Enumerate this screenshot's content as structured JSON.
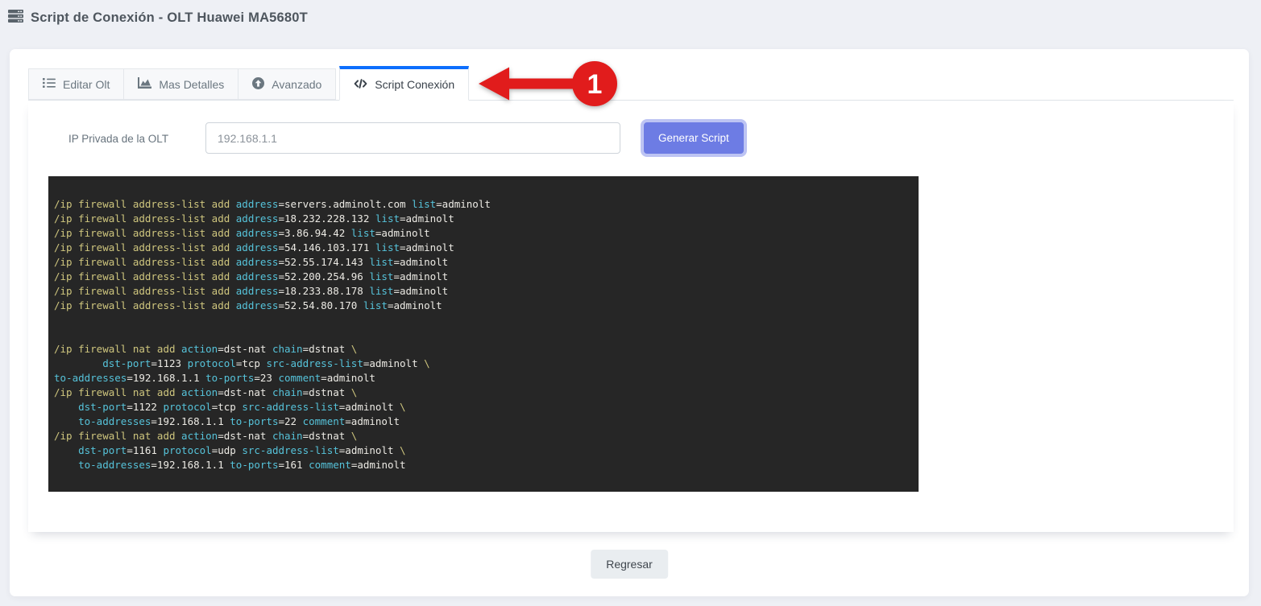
{
  "header": {
    "title": "Script de Conexión - OLT Huawei MA5680T"
  },
  "tabs": [
    {
      "label": "Editar Olt",
      "icon": "list-icon",
      "active": false
    },
    {
      "label": "Mas Detalles",
      "icon": "chart-area-icon",
      "active": false
    },
    {
      "label": "Avanzado",
      "icon": "arrow-circle-up-icon",
      "active": false
    },
    {
      "label": "Script Conexión",
      "icon": "code-icon",
      "active": true
    }
  ],
  "form": {
    "ip_label": "IP Privada de la OLT",
    "ip_value": "192.168.1.1",
    "generate_button_label": "Generar Script"
  },
  "footer": {
    "back_button_label": "Regresar"
  },
  "annotation": {
    "step_number": "1"
  },
  "colors": {
    "accent_blue": "#0d6efd",
    "button_purple": "#6d7ce4",
    "code_bg": "#262626",
    "code_yellow": "#cfc67e",
    "code_cyan": "#56c3da",
    "code_white": "#eceae4",
    "annotation_red": "#e11c1c"
  },
  "code": {
    "lines": [
      [
        [
          "y",
          "/ip firewall address-list add "
        ],
        [
          "c",
          "address"
        ],
        [
          "w",
          "=servers.adminolt.com "
        ],
        [
          "c",
          "list"
        ],
        [
          "w",
          "=adminolt"
        ]
      ],
      [
        [
          "y",
          "/ip firewall address-list add "
        ],
        [
          "c",
          "address"
        ],
        [
          "w",
          "=18.232.228.132 "
        ],
        [
          "c",
          "list"
        ],
        [
          "w",
          "=adminolt"
        ]
      ],
      [
        [
          "y",
          "/ip firewall address-list add "
        ],
        [
          "c",
          "address"
        ],
        [
          "w",
          "=3.86.94.42 "
        ],
        [
          "c",
          "list"
        ],
        [
          "w",
          "=adminolt"
        ]
      ],
      [
        [
          "y",
          "/ip firewall address-list add "
        ],
        [
          "c",
          "address"
        ],
        [
          "w",
          "=54.146.103.171 "
        ],
        [
          "c",
          "list"
        ],
        [
          "w",
          "=adminolt"
        ]
      ],
      [
        [
          "y",
          "/ip firewall address-list add "
        ],
        [
          "c",
          "address"
        ],
        [
          "w",
          "=52.55.174.143 "
        ],
        [
          "c",
          "list"
        ],
        [
          "w",
          "=adminolt"
        ]
      ],
      [
        [
          "y",
          "/ip firewall address-list add "
        ],
        [
          "c",
          "address"
        ],
        [
          "w",
          "=52.200.254.96 "
        ],
        [
          "c",
          "list"
        ],
        [
          "w",
          "=adminolt"
        ]
      ],
      [
        [
          "y",
          "/ip firewall address-list add "
        ],
        [
          "c",
          "address"
        ],
        [
          "w",
          "=18.233.88.178 "
        ],
        [
          "c",
          "list"
        ],
        [
          "w",
          "=adminolt"
        ]
      ],
      [
        [
          "y",
          "/ip firewall address-list add "
        ],
        [
          "c",
          "address"
        ],
        [
          "w",
          "=52.54.80.170 "
        ],
        [
          "c",
          "list"
        ],
        [
          "w",
          "=adminolt"
        ]
      ],
      [],
      [],
      [
        [
          "y",
          "/ip firewall nat add "
        ],
        [
          "c",
          "action"
        ],
        [
          "w",
          "=dst-nat "
        ],
        [
          "c",
          "chain"
        ],
        [
          "w",
          "=dstnat "
        ],
        [
          "y",
          "\\"
        ]
      ],
      [
        [
          "w",
          "        "
        ],
        [
          "c",
          "dst-port"
        ],
        [
          "w",
          "=1123 "
        ],
        [
          "c",
          "protocol"
        ],
        [
          "w",
          "=tcp "
        ],
        [
          "c",
          "src-address-list"
        ],
        [
          "w",
          "=adminolt "
        ],
        [
          "y",
          "\\"
        ]
      ],
      [
        [
          "c",
          "to-addresses"
        ],
        [
          "w",
          "=192.168.1.1 "
        ],
        [
          "c",
          "to-ports"
        ],
        [
          "w",
          "=23 "
        ],
        [
          "c",
          "comment"
        ],
        [
          "w",
          "=adminolt"
        ]
      ],
      [
        [
          "y",
          "/ip firewall nat add "
        ],
        [
          "c",
          "action"
        ],
        [
          "w",
          "=dst-nat "
        ],
        [
          "c",
          "chain"
        ],
        [
          "w",
          "=dstnat "
        ],
        [
          "y",
          "\\"
        ]
      ],
      [
        [
          "w",
          "    "
        ],
        [
          "c",
          "dst-port"
        ],
        [
          "w",
          "=1122 "
        ],
        [
          "c",
          "protocol"
        ],
        [
          "w",
          "=tcp "
        ],
        [
          "c",
          "src-address-list"
        ],
        [
          "w",
          "=adminolt "
        ],
        [
          "y",
          "\\"
        ]
      ],
      [
        [
          "w",
          "    "
        ],
        [
          "c",
          "to-addresses"
        ],
        [
          "w",
          "=192.168.1.1 "
        ],
        [
          "c",
          "to-ports"
        ],
        [
          "w",
          "=22 "
        ],
        [
          "c",
          "comment"
        ],
        [
          "w",
          "=adminolt"
        ]
      ],
      [
        [
          "y",
          "/ip firewall nat add "
        ],
        [
          "c",
          "action"
        ],
        [
          "w",
          "=dst-nat "
        ],
        [
          "c",
          "chain"
        ],
        [
          "w",
          "=dstnat "
        ],
        [
          "y",
          "\\"
        ]
      ],
      [
        [
          "w",
          "    "
        ],
        [
          "c",
          "dst-port"
        ],
        [
          "w",
          "=1161 "
        ],
        [
          "c",
          "protocol"
        ],
        [
          "w",
          "=udp "
        ],
        [
          "c",
          "src-address-list"
        ],
        [
          "w",
          "=adminolt "
        ],
        [
          "y",
          "\\"
        ]
      ],
      [
        [
          "w",
          "    "
        ],
        [
          "c",
          "to-addresses"
        ],
        [
          "w",
          "=192.168.1.1 "
        ],
        [
          "c",
          "to-ports"
        ],
        [
          "w",
          "=161 "
        ],
        [
          "c",
          "comment"
        ],
        [
          "w",
          "=adminolt"
        ]
      ]
    ]
  }
}
